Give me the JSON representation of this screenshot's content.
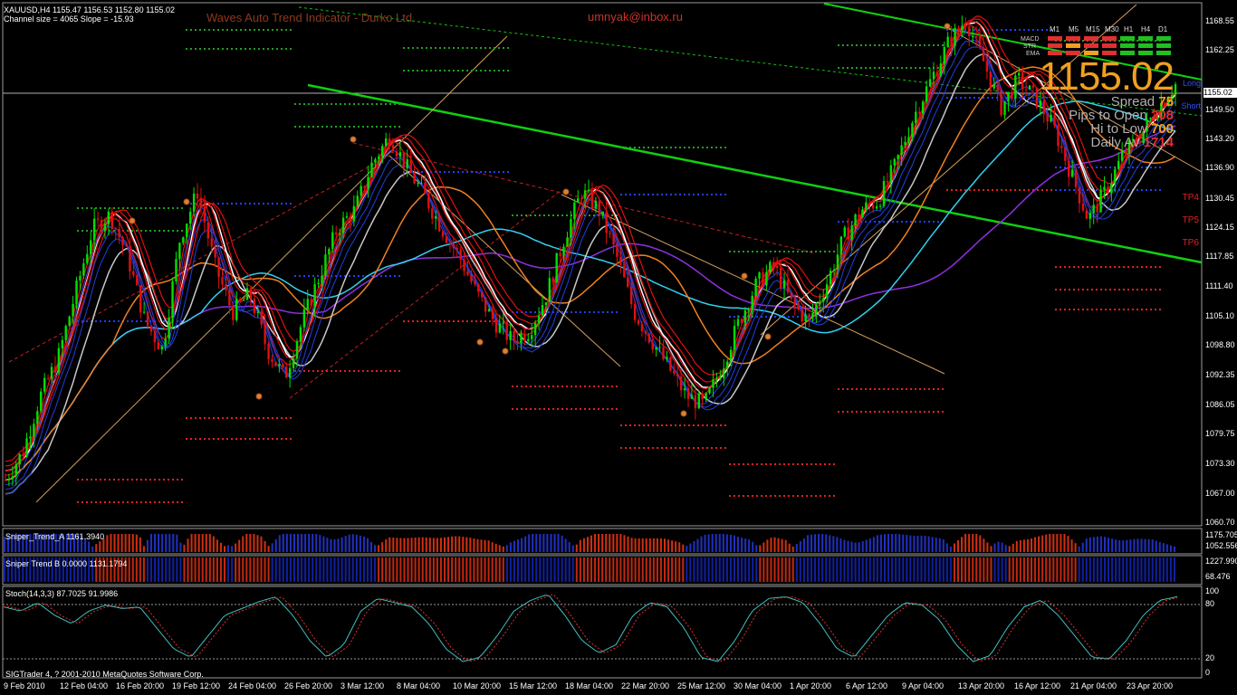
{
  "header": {
    "symbol_line": "XAUUSD,H4  1155.47 1156.53 1152.80 1155.02",
    "channel_line": "Channel size = 4065 Slope = -15.93"
  },
  "brand_text": "Waves Auto Trend Indicator - Durko Ltd",
  "email_text": "umnyak@inbox.ru",
  "big_price": "1155.02",
  "info_panel": [
    {
      "label": "Spread",
      "value": "75",
      "color": "#f0a020"
    },
    {
      "label": "Pips to Open",
      "value": "208",
      "color": "#e03030"
    },
    {
      "label": "Hi to Low",
      "value": "700",
      "color": "#f0a020"
    },
    {
      "label": "Daily Av",
      "value": "1714",
      "color": "#e03030"
    }
  ],
  "timeframes": [
    "M1",
    "M5",
    "M15",
    "M30",
    "H1",
    "H4",
    "D1"
  ],
  "signal_rows": [
    "MACD",
    "STR",
    "EMA"
  ],
  "side_labels": {
    "long": "Long",
    "short": "Short"
  },
  "tp_labels": [
    "TP4",
    "TP5",
    "TP6"
  ],
  "current_price_label": "1155.02",
  "panels": {
    "sniper_a": "Sniper_Trend_A 1161.3940",
    "sniper_b": "Sniper Trend B 0.0000 1131.1794",
    "stoch": "Stoch(14,3,3) 87.7025 91.9986"
  },
  "copyright": "SIGTrader 4, ? 2001-2010 MetaQuotes Software Corp.",
  "colors": {
    "background": "#000000",
    "bull_candle": "#00e000",
    "bear_candle": "#e01010",
    "channel_line": "#00d000",
    "support_dots": "#2040ff",
    "resistance_dots": "#e02020",
    "target_dots": "#20a020"
  },
  "chart_data": {
    "type": "candlestick",
    "symbol": "XAUUSD",
    "timeframe": "H4",
    "ylim": [
      1060.7,
      1172.0
    ],
    "y_ticks": [
      "1168.55",
      "1162.25",
      "1155.02",
      "1149.50",
      "1143.20",
      "1136.90",
      "1130.45",
      "1124.15",
      "1117.85",
      "1111.40",
      "1105.10",
      "1098.80",
      "1092.35",
      "1086.05",
      "1079.75",
      "1073.30",
      "1067.00",
      "1060.70"
    ],
    "x_labels": [
      "9 Feb 2010",
      "12 Feb 04:00",
      "16 Feb 20:00",
      "19 Feb 12:00",
      "24 Feb 04:00",
      "26 Feb 20:00",
      "3 Mar 12:00",
      "8 Mar 04:00",
      "10 Mar 20:00",
      "15 Mar 12:00",
      "18 Mar 04:00",
      "22 Mar 20:00",
      "25 Mar 12:00",
      "30 Mar 04:00",
      "1 Apr 20:00",
      "6 Apr 12:00",
      "9 Apr 04:00",
      "13 Apr 20:00",
      "16 Apr 12:00",
      "21 Apr 04:00",
      "23 Apr 20:00"
    ],
    "price_path": [
      1070,
      1076,
      1088,
      1096,
      1110,
      1124,
      1127,
      1118,
      1104,
      1098,
      1122,
      1132,
      1116,
      1106,
      1110,
      1098,
      1092,
      1104,
      1114,
      1124,
      1128,
      1138,
      1144,
      1137,
      1131,
      1124,
      1118,
      1110,
      1104,
      1100,
      1102,
      1110,
      1122,
      1132,
      1128,
      1118,
      1106,
      1100,
      1094,
      1088,
      1086,
      1094,
      1104,
      1112,
      1116,
      1108,
      1104,
      1112,
      1122,
      1128,
      1130,
      1138,
      1148,
      1156,
      1164,
      1169,
      1160,
      1150,
      1156,
      1152,
      1146,
      1136,
      1126,
      1132,
      1140,
      1144,
      1150,
      1155
    ],
    "sniper_a_axis": [
      "1175.7059",
      "1052.5566"
    ],
    "sniper_b_axis": [
      "1227.9904",
      "68.476"
    ],
    "stoch_levels": [
      100,
      80,
      20,
      0
    ],
    "stoch_k": [
      80,
      75,
      85,
      70,
      60,
      75,
      82,
      78,
      80,
      55,
      30,
      20,
      45,
      70,
      78,
      86,
      92,
      70,
      40,
      20,
      35,
      75,
      90,
      85,
      80,
      60,
      30,
      15,
      20,
      45,
      75,
      88,
      95,
      70,
      40,
      25,
      35,
      70,
      85,
      80,
      55,
      20,
      15,
      40,
      75,
      90,
      92,
      85,
      60,
      30,
      20,
      45,
      70,
      85,
      82,
      65,
      35,
      15,
      22,
      55,
      80,
      88,
      70,
      45,
      20,
      18,
      40,
      70,
      88,
      92
    ]
  }
}
